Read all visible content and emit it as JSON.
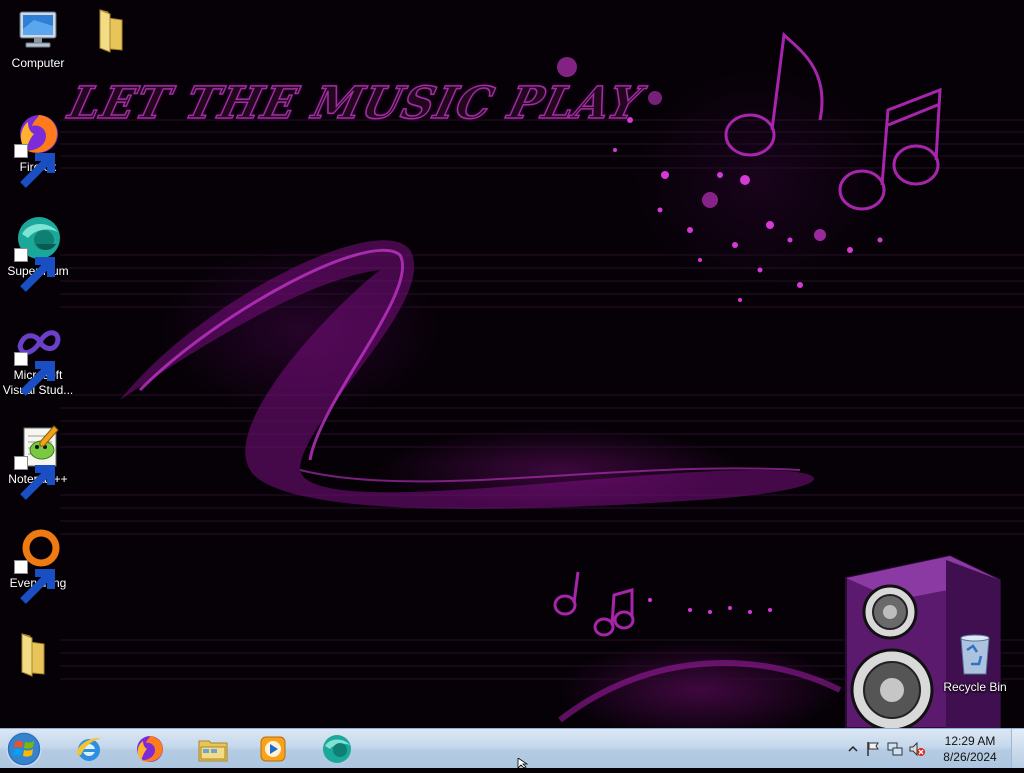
{
  "wallpaper": {
    "title_text": "LET THE MUSIC PLAY",
    "accent_color": "#b021b6"
  },
  "desktop_icons": [
    {
      "label": "Computer",
      "icon": "computer-icon",
      "shortcut": false
    },
    {
      "label": "",
      "icon": "folder-icon",
      "shortcut": false
    },
    {
      "label": "Firefox",
      "icon": "firefox-icon",
      "shortcut": true
    },
    {
      "label": "Supermium",
      "icon": "supermium-icon",
      "shortcut": true
    },
    {
      "label": "Microsoft Visual Stud...",
      "icon": "visual-studio-icon",
      "shortcut": true
    },
    {
      "label": "Notepad++",
      "icon": "notepadpp-icon",
      "shortcut": true
    },
    {
      "label": "Everything",
      "icon": "everything-icon",
      "shortcut": true
    },
    {
      "label": "",
      "icon": "folder-icon",
      "shortcut": false
    },
    {
      "label": "Recycle Bin",
      "icon": "recycle-bin-icon",
      "shortcut": false
    }
  ],
  "taskbar": {
    "start_icon": "windows-logo-icon",
    "pinned": [
      {
        "name": "Internet Explorer",
        "icon": "internet-explorer-icon"
      },
      {
        "name": "Firefox",
        "icon": "firefox-icon"
      },
      {
        "name": "Windows Explorer",
        "icon": "file-explorer-icon"
      },
      {
        "name": "Windows Media Player",
        "icon": "media-player-icon"
      },
      {
        "name": "Supermium",
        "icon": "supermium-icon"
      }
    ],
    "tray": {
      "icons": [
        "show-hidden-icons-chevron",
        "action-center-flag-icon",
        "network-icon",
        "volume-muted-icon"
      ],
      "time": "12:29 AM",
      "date": "8/26/2024"
    }
  }
}
